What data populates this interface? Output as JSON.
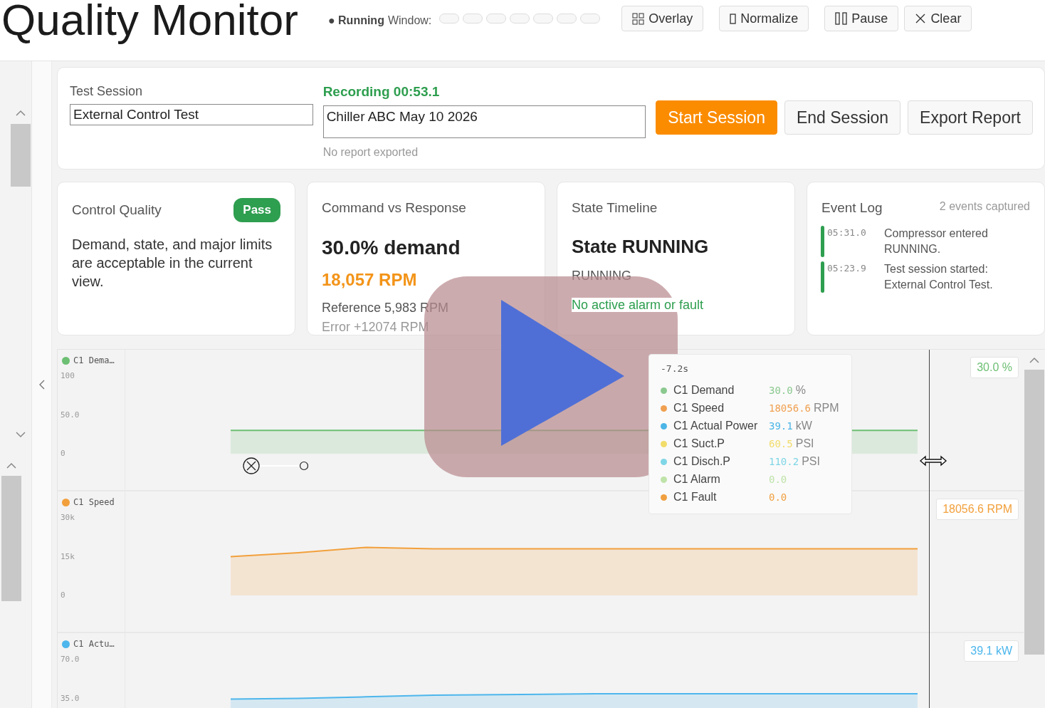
{
  "header": {
    "title": "Quality Monitor",
    "status": "● Running",
    "window_label": "Window:",
    "window_options": [
      {
        "selected": false
      },
      {
        "selected": false
      },
      {
        "selected": false
      },
      {
        "selected": false
      },
      {
        "selected": false
      },
      {
        "selected": false
      },
      {
        "selected": false
      }
    ],
    "buttons": [
      {
        "kind": "overlay",
        "label": "Overlay"
      },
      {
        "kind": "normalize",
        "label": "Normalize"
      },
      {
        "kind": "pause",
        "label": "Pause"
      },
      {
        "kind": "clear",
        "label": "Clear"
      }
    ]
  },
  "session": {
    "label": "Test Session",
    "name_value": "External Control Test",
    "recording": "Recording 00:53.1",
    "unit_value": "Chiller ABC May 10 2026",
    "report_status": "No report exported",
    "buttons": [
      {
        "label": "Start Session",
        "primary": true
      },
      {
        "label": "End Session",
        "primary": false
      },
      {
        "label": "Export Report",
        "primary": false
      }
    ]
  },
  "control_quality": {
    "title": "Control Quality",
    "badge": "Pass",
    "text": "Demand, state, and major limits are acceptable in the current view."
  },
  "command_response": {
    "title": "Command vs Response",
    "demand": "30.0% demand",
    "rpm": "18,057 RPM",
    "reference": "Reference 5,983 RPM",
    "error": "Error +12074 RPM"
  },
  "state_timeline": {
    "title": "State Timeline",
    "state": "State RUNNING",
    "detail": "RUNNING",
    "alarm": "No active alarm or fault"
  },
  "event_log": {
    "title": "Event Log",
    "count": "2 events captured",
    "events": [
      {
        "time": "05:31.0",
        "text": "Compressor entered RUNNING."
      },
      {
        "time": "05:23.9",
        "text": "Test session started: External Control Test."
      }
    ]
  },
  "strips": [
    {
      "label": "C1 Dema…",
      "color": "#6dbf73",
      "value": "30.0 %",
      "ticks": [
        "100",
        "50.0",
        "0"
      ]
    },
    {
      "label": "C1 Speed",
      "color": "#f2a03c",
      "value": "18056.6 RPM",
      "ticks": [
        "30k",
        "15k",
        "0"
      ]
    },
    {
      "label": "C1 Actu…",
      "color": "#4db6ec",
      "value": "39.1 kW",
      "ticks": [
        "70.0",
        "35.0"
      ]
    }
  ],
  "tooltip": {
    "time": "-7.2s",
    "items": [
      {
        "name": "C1 Demand",
        "value": "30.0",
        "unit": "%",
        "color": "#8bc98f"
      },
      {
        "name": "C1 Speed",
        "value": "18056.6",
        "unit": "RPM",
        "color": "#f0a050"
      },
      {
        "name": "C1 Actual Power",
        "value": "39.1",
        "unit": "kW",
        "color": "#4bb5e6"
      },
      {
        "name": "C1 Suct.P",
        "value": "60.5",
        "unit": "PSI",
        "color": "#f2dc6a"
      },
      {
        "name": "C1 Disch.P",
        "value": "110.2",
        "unit": "PSI",
        "color": "#7fd6e6"
      },
      {
        "name": "C1 Alarm",
        "value": "0.0",
        "color": "#bfe3a9"
      },
      {
        "name": "C1 Fault",
        "value": "0.0",
        "color": "#f0a040"
      }
    ]
  }
}
